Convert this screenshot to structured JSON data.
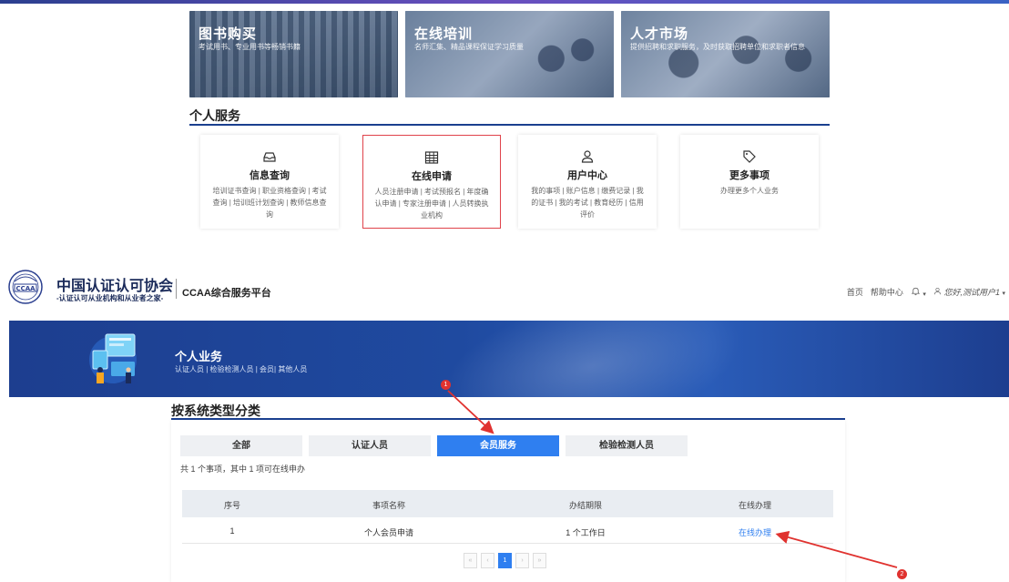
{
  "banners": [
    {
      "title": "图书购买",
      "subtitle": "考试用书、专业用书等畅销书籍"
    },
    {
      "title": "在线培训",
      "subtitle": "名师汇集、精品课程保证学习质量"
    },
    {
      "title": "人才市场",
      "subtitle": "提供招聘和求职服务，及时获取招聘单位和求职者信息"
    }
  ],
  "personal_services": {
    "title": "个人服务",
    "cards": [
      {
        "icon": "inbox-icon",
        "title": "信息查询",
        "desc": "培训证书查询 | 职业资格查询 | 考试查询 | 培训班计划查询 | 教师信息查询"
      },
      {
        "icon": "table-icon",
        "title": "在线申请",
        "desc": "人员注册申请 | 考试预报名 | 年度确认申请 | 专家注册申请 | 人员转换执业机构"
      },
      {
        "icon": "user-icon",
        "title": "用户中心",
        "desc": "我的事项 | 账户信息 | 缴费记录 | 我的证书 | 我的考试 | 教育经历 | 信用评价"
      },
      {
        "icon": "tag-icon",
        "title": "更多事项",
        "desc": "办理更多个人业务"
      }
    ]
  },
  "header": {
    "org_name": "中国认证认可协会",
    "slogan": "-认证认可从业机构和从业者之家-",
    "logo_text": "CCAA",
    "platform": "CCAA综合服务平台",
    "nav": {
      "home": "首页",
      "help": "帮助中心",
      "user": "您好,测试用户1"
    }
  },
  "hero": {
    "title": "个人业务",
    "subtitle": "认证人员 | 检验检测人员 | 会员| 其他人员"
  },
  "category": {
    "title": "按系统类型分类",
    "tabs": [
      "全部",
      "认证人员",
      "会员服务",
      "检验检测人员"
    ],
    "active_tab": "会员服务",
    "count_text": "共 1 个事项，其中 1 项可在线申办",
    "columns": [
      "序号",
      "事项名称",
      "办结期限",
      "在线办理"
    ],
    "rows": [
      {
        "no": "1",
        "name": "个人会员申请",
        "term": "1 个工作日",
        "action": "在线办理"
      }
    ]
  },
  "pager": {
    "first": "«",
    "prev": "‹",
    "current": "1",
    "next": "›",
    "last": "»"
  },
  "markers": {
    "one": "1",
    "two": "2"
  },
  "colors": {
    "primary": "#2f7ff0",
    "navy": "#1a3f8f",
    "highlight": "#e0424a",
    "marker": "#e0322f"
  }
}
